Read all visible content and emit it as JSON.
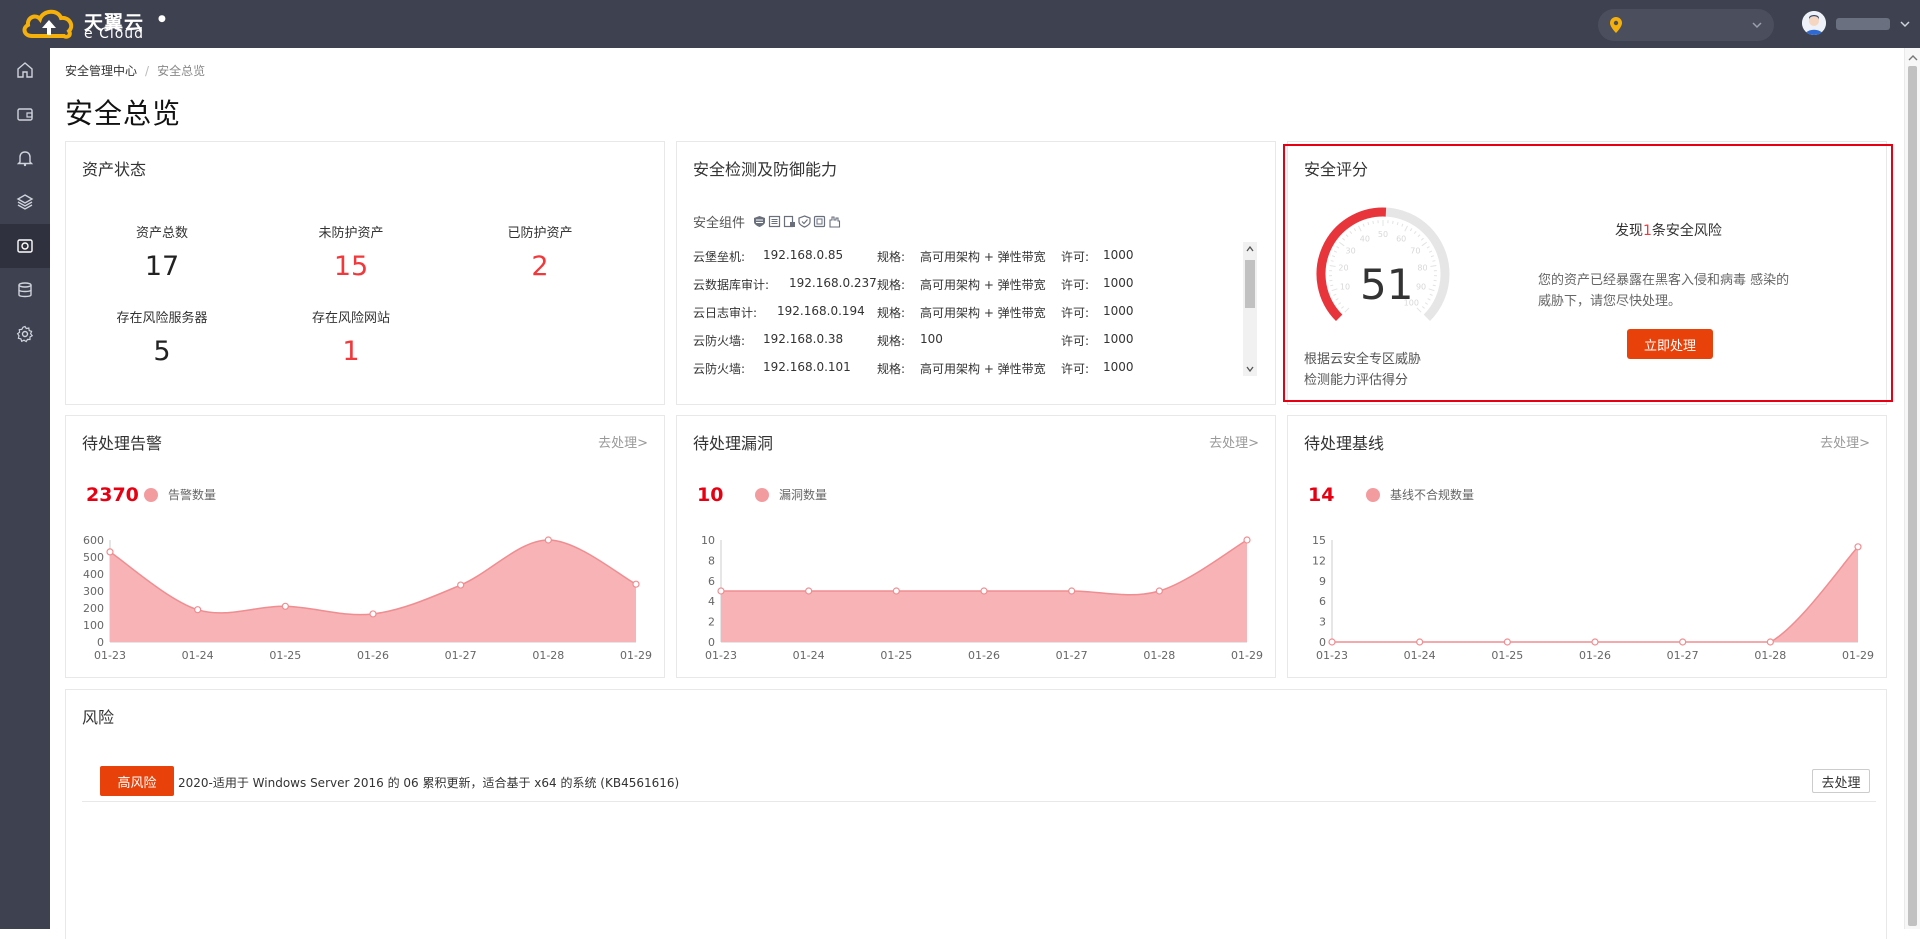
{
  "brand": {
    "name_cn": "天翼云",
    "name_en": "e Cloud",
    "dot": "●"
  },
  "header": {
    "region_value": "",
    "user_chevron": "⌄"
  },
  "sidebar": {
    "items": [
      {
        "name": "home-icon"
      },
      {
        "name": "wallet-icon"
      },
      {
        "name": "bell-icon"
      },
      {
        "name": "layers-icon"
      },
      {
        "name": "security-center-icon"
      },
      {
        "name": "database-icon"
      },
      {
        "name": "gear-icon"
      }
    ]
  },
  "breadcrumb": {
    "root": "安全管理中心",
    "current": "安全总览"
  },
  "page_title": "安全总览",
  "asset_status": {
    "title": "资产状态",
    "items": [
      {
        "label": "资产总数",
        "value": "17",
        "color": "#222222"
      },
      {
        "label": "未防护资产",
        "value": "15",
        "color": "#f2383a"
      },
      {
        "label": "已防护资产",
        "value": "2",
        "color": "#f2383a"
      },
      {
        "label": "存在风险服务器",
        "value": "5",
        "color": "#222222"
      },
      {
        "label": "存在风险网站",
        "value": "1",
        "color": "#f2383a"
      }
    ]
  },
  "detection": {
    "title": "安全检测及防御能力",
    "components_label": "安全组件",
    "rows": [
      {
        "name": "云堡垒机:",
        "ip": "192.168.0.85",
        "spec_label": "规格:",
        "spec": "高可用架构 + 弹性带宽",
        "license_label": "许可:",
        "license": "1000"
      },
      {
        "name": "云数据库审计:",
        "ip": "192.168.0.237",
        "spec_label": "规格:",
        "spec": "高可用架构 + 弹性带宽",
        "license_label": "许可:",
        "license": "1000"
      },
      {
        "name": "云日志审计:",
        "ip": "192.168.0.194",
        "spec_label": "规格:",
        "spec": "高可用架构 + 弹性带宽",
        "license_label": "许可:",
        "license": "1000"
      },
      {
        "name": "云防火墙:",
        "ip": "192.168.0.38",
        "spec_label": "规格:",
        "spec": "100",
        "license_label": "许可:",
        "license": "1000"
      },
      {
        "name": "云防火墙:",
        "ip": "192.168.0.101",
        "spec_label": "规格:",
        "spec": "高可用架构 + 弹性带宽",
        "license_label": "许可:",
        "license": "1000"
      }
    ]
  },
  "score": {
    "title": "安全评分",
    "value": "51",
    "value_fraction": 0.51,
    "gauge_ticks": [
      "10",
      "20",
      "30",
      "40",
      "50",
      "60",
      "70",
      "80",
      "90",
      "100"
    ],
    "desc_line1": "根据云安全专区威胁",
    "desc_line2": "检测能力评估得分",
    "found_prefix": "发现",
    "found_count": "1",
    "found_suffix": "条安全风险",
    "risk_text": "您的资产已经暴露在黑客入侵和病毒 感染的威胁下，请您尽快处理。",
    "action_label": "立即处理",
    "accent_color": "#e8420a"
  },
  "alerts": {
    "title": "待处理告警",
    "link": "去处理>",
    "total": "2370",
    "legend": "告警数量"
  },
  "vulns": {
    "title": "待处理漏洞",
    "link": "去处理>",
    "total": "10",
    "legend": "漏洞数量"
  },
  "baseline": {
    "title": "待处理基线",
    "link": "去处理>",
    "total": "14",
    "legend": "基线不合规数量"
  },
  "chart_data": [
    {
      "type": "area",
      "title": "待处理告警",
      "series": [
        {
          "name": "告警数量",
          "values": [
            530,
            190,
            210,
            165,
            335,
            600,
            340
          ]
        }
      ],
      "categories": [
        "01-23",
        "01-24",
        "01-25",
        "01-26",
        "01-27",
        "01-28",
        "01-29"
      ],
      "yticks": [
        "0",
        "100",
        "200",
        "300",
        "400",
        "500",
        "600"
      ],
      "ylim": [
        0,
        600
      ],
      "color": "#f7b3b5"
    },
    {
      "type": "area",
      "title": "待处理漏洞",
      "series": [
        {
          "name": "漏洞数量",
          "values": [
            5,
            5,
            5,
            5,
            5,
            5,
            10
          ]
        }
      ],
      "categories": [
        "01-23",
        "01-24",
        "01-25",
        "01-26",
        "01-27",
        "01-28",
        "01-29"
      ],
      "yticks": [
        "0",
        "2",
        "4",
        "6",
        "8",
        "10"
      ],
      "ylim": [
        0,
        10
      ],
      "color": "#f7b3b5"
    },
    {
      "type": "area",
      "title": "待处理基线",
      "series": [
        {
          "name": "基线不合规数量",
          "values": [
            0,
            0,
            0,
            0,
            0,
            0,
            14
          ]
        }
      ],
      "categories": [
        "01-23",
        "01-24",
        "01-25",
        "01-26",
        "01-27",
        "01-28",
        "01-29"
      ],
      "yticks": [
        "0",
        "3",
        "6",
        "9",
        "12",
        "15"
      ],
      "ylim": [
        0,
        15
      ],
      "color": "#f7b3b5"
    }
  ],
  "risk": {
    "title": "风险",
    "items": [
      {
        "level": "高风险",
        "text": "2020-适用于 Windows Server 2016 的 06 累积更新，适合基于 x64 的系统 (KB4561616)",
        "action": "去处理"
      }
    ]
  }
}
